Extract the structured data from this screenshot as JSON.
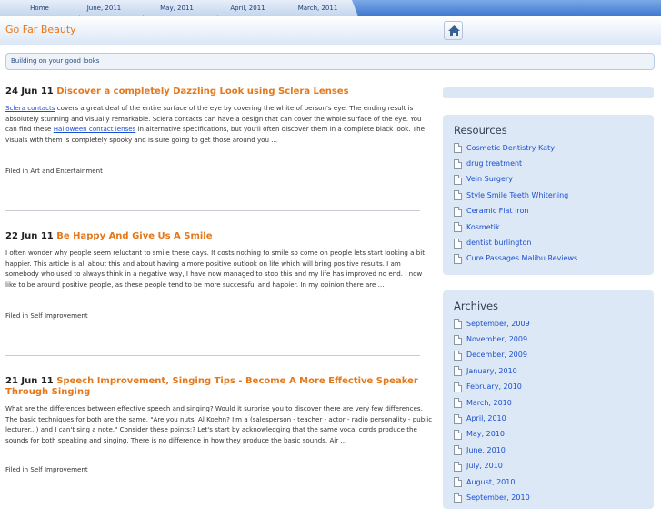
{
  "nav": {
    "tabs": [
      "Home",
      "June, 2011",
      "May, 2011",
      "April, 2011",
      "March, 2011"
    ]
  },
  "header": {
    "site_title": "Go Far Beauty",
    "tagline": "Building on your good looks"
  },
  "posts": [
    {
      "date": "24 Jun 11",
      "title": "Discover a completely Dazzling Look using Sclera Lenses",
      "body_link_1": "Sclera contacts",
      "body_part_1": " covers a great deal of the entire surface of the eye by covering the white of person's eye. The ending result is absolutely stunning and visually remarkable. Sclera contacts can have a design that can cover the whole surface of the eye. You can find these ",
      "body_link_2": "Halloween contact lenses",
      "body_part_2": " in alternative specifications, but you'll often discover them in a complete black look. The visuals with them is completely spooky and is sure going to get those around you ...",
      "filed": "Filed in Art and Entertainment"
    },
    {
      "date": "22 Jun 11",
      "title": "Be Happy And Give Us A Smile",
      "body": "I often wonder why people seem reluctant to smile these days. It costs nothing to smile so come on people lets start looking a bit happier. This article is all about this and about having a more positive outlook on life which will bring positive results. I am somebody who used to always think in a negative way, I have now managed to stop this and my life has improved no end. I now like to be around positive people, as these people tend to be more successful and happier. In my opinion there are ...",
      "filed": "Filed in Self Improvement"
    },
    {
      "date": "21 Jun 11",
      "title": "Speech Improvement, Singing Tips - Become A More Effective Speaker Through Singing",
      "body": "What are the differences between effective speech and singing? Would it surprise you to discover there are very few differences. The basic techniques for both are the same. \"Are you nuts, Al Koehn? I'm a (salesperson - teacher - actor - radio personality - public lecturer...) and I can't sing a note.\" Consider these points:? Let's start by acknowledging that the same vocal cords produce the sounds for both speaking and singing. There is no difference in how they produce the basic sounds. Air ...",
      "filed": "Filed in Self Improvement"
    }
  ],
  "sidebar": {
    "resources": {
      "title": "Resources",
      "items": [
        "Cosmetic Dentistry Katy",
        "drug treatment",
        "Vein Surgery",
        "Style Smile Teeth Whitening",
        "Ceramic Flat Iron",
        "Kosmetik",
        "dentist burlington",
        "Cure Passages Malibu Reviews"
      ]
    },
    "archives": {
      "title": "Archives",
      "items": [
        "September, 2009",
        "November, 2009",
        "December, 2009",
        "January, 2010",
        "February, 2010",
        "March, 2010",
        "April, 2010",
        "May, 2010",
        "June, 2010",
        "July, 2010",
        "August, 2010",
        "September, 2010"
      ]
    }
  },
  "colors": {
    "accent_orange": "#e4781a",
    "link_blue": "#1a4fd0",
    "widget_bg": "#dde8f6"
  }
}
